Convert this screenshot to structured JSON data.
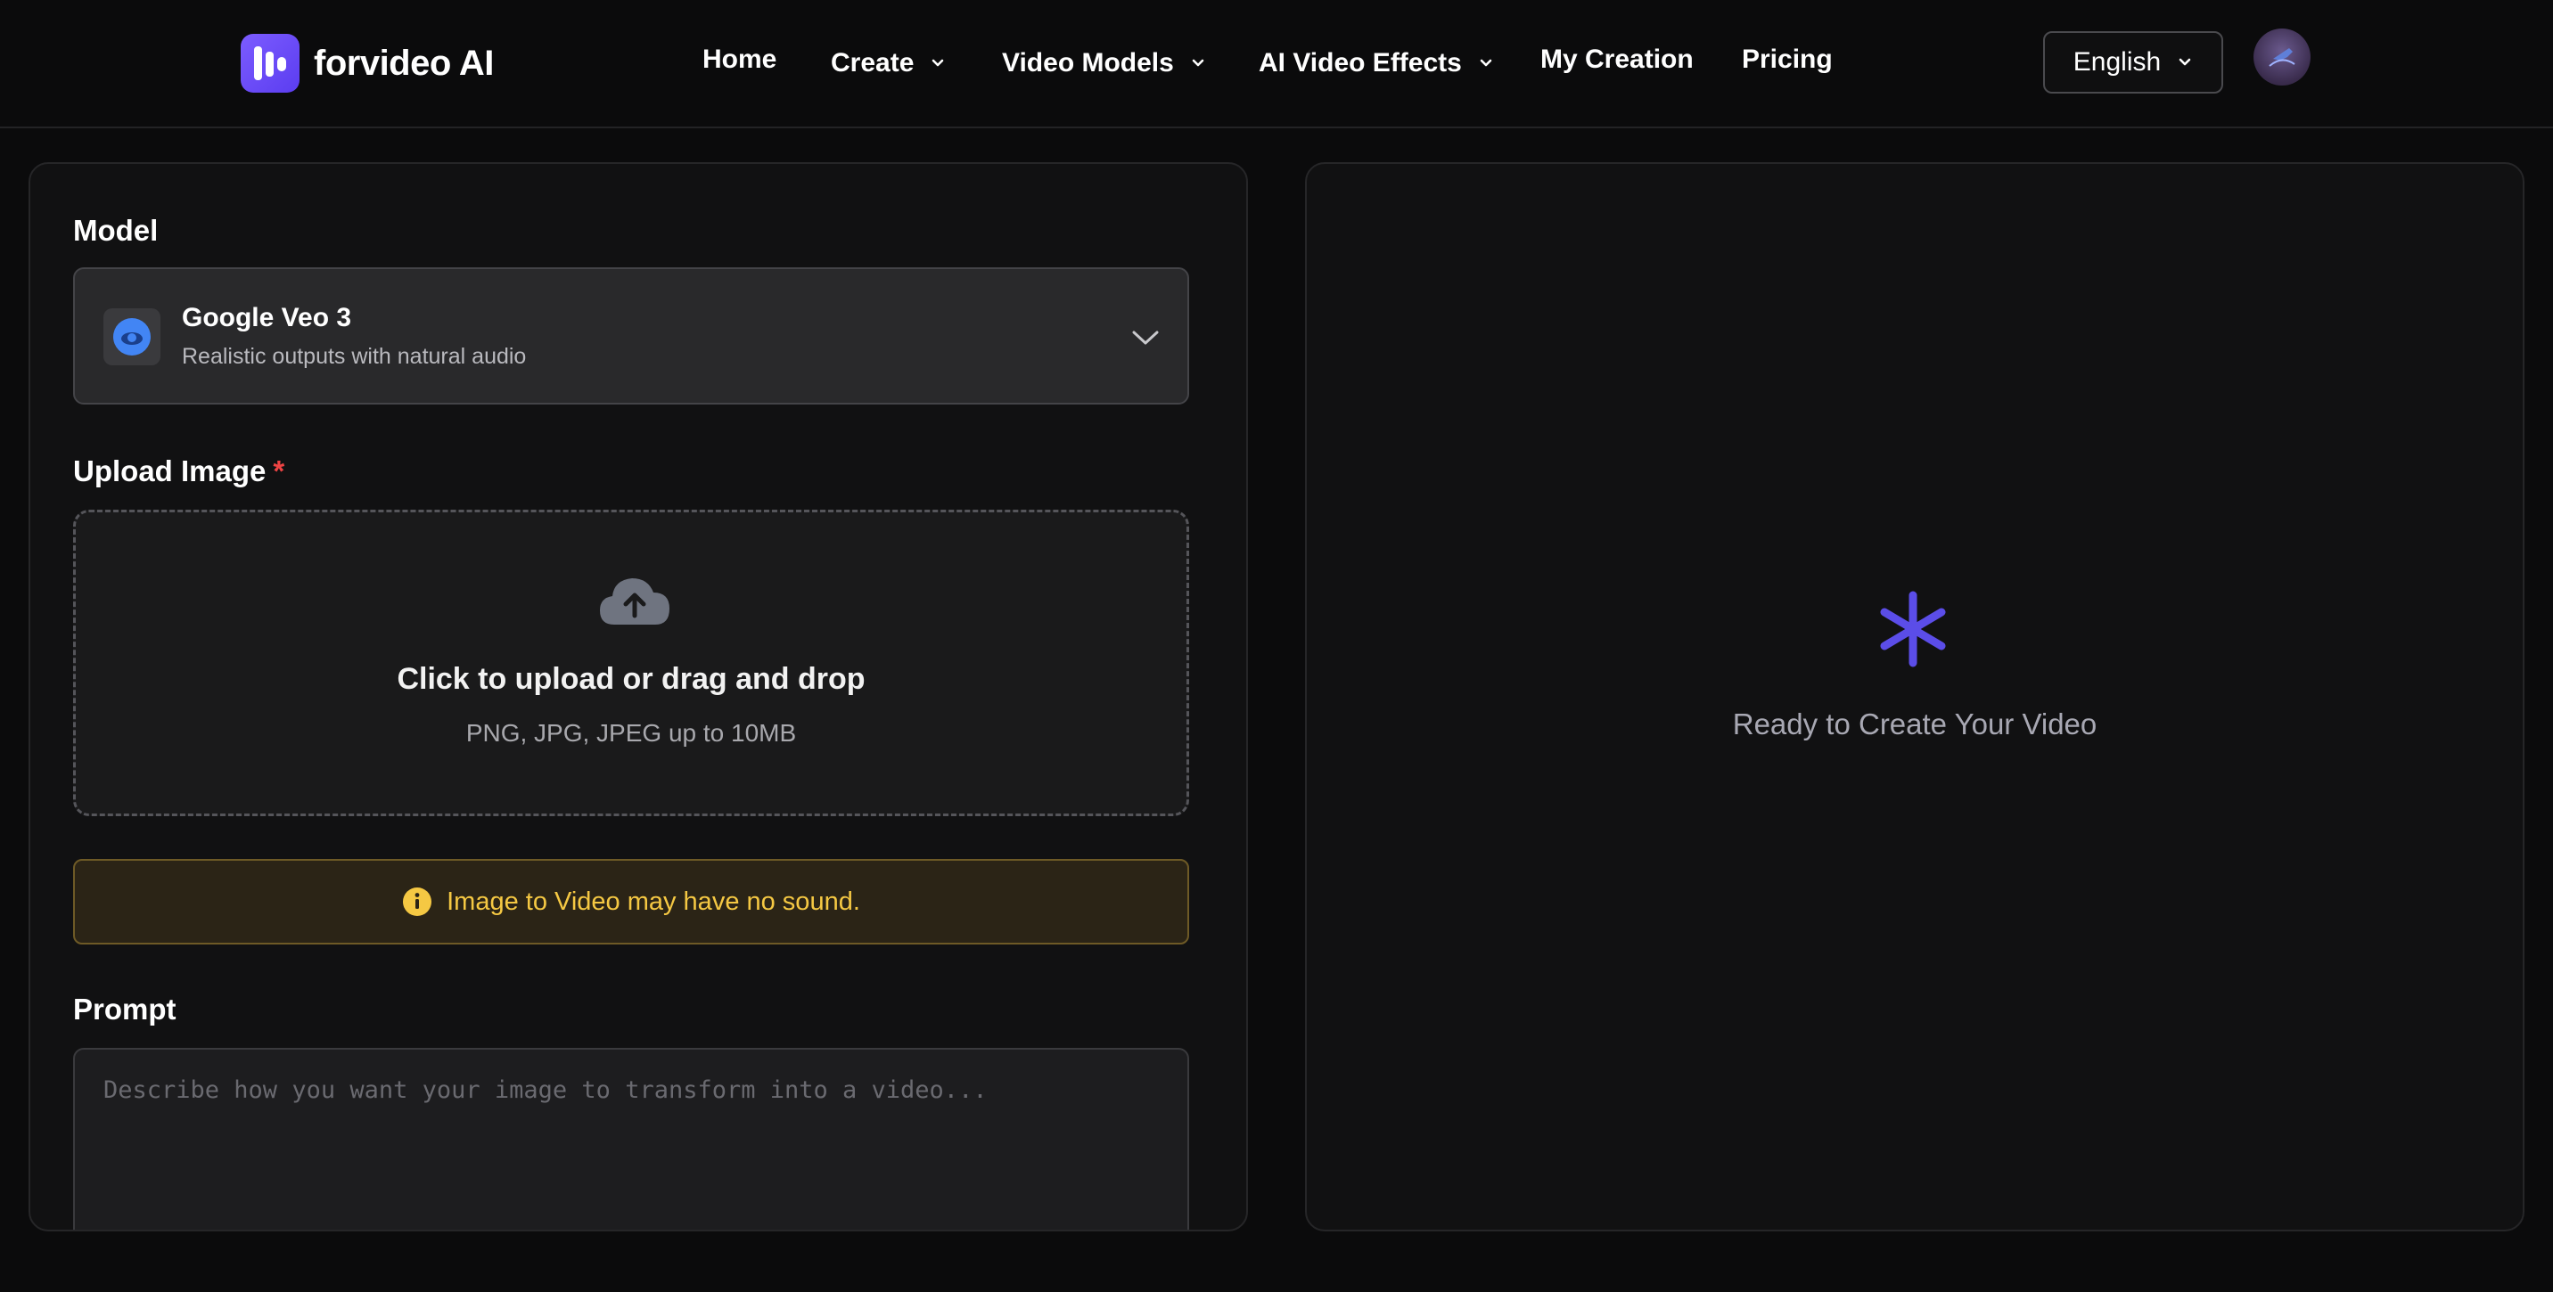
{
  "header": {
    "brand": "forvideo AI",
    "nav": {
      "home": "Home",
      "create": "Create",
      "video_models": "Video Models",
      "ai_video_effects": "AI Video Effects",
      "my_creation": "My Creation",
      "pricing": "Pricing"
    },
    "language": "English"
  },
  "form": {
    "model_label": "Model",
    "model": {
      "name": "Google Veo 3",
      "description": "Realistic outputs with natural audio"
    },
    "upload_label": "Upload Image",
    "required_mark": "*",
    "upload": {
      "title": "Click to upload or drag and drop",
      "hint": "PNG, JPG, JPEG up to 10MB"
    },
    "notice": "Image to Video may have no sound.",
    "prompt_label": "Prompt",
    "prompt_placeholder": "Describe how you want your image to transform into a video..."
  },
  "preview": {
    "ready_text": "Ready to Create Your Video"
  },
  "colors": {
    "accent": "#5b4de8",
    "warning": "#f5c843",
    "required": "#ef4444"
  }
}
